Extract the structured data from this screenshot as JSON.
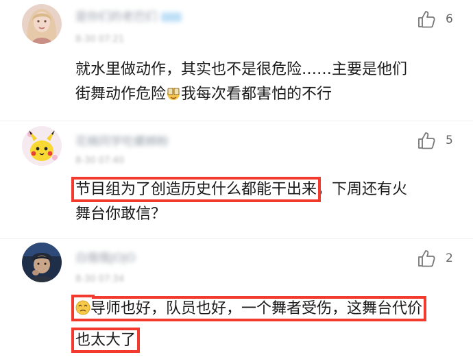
{
  "comments": [
    {
      "username": "是你们的老巴们",
      "time": "8-30 07:21",
      "likes": "6",
      "lines": [
        "就水里做动作，其实也不是很危险……主要是他们",
        "街舞动作危险",
        "我每次看都害怕的不行"
      ],
      "emoji": "cheers-emoji"
    },
    {
      "username": "花楠同学吃螺蛳粉",
      "time": "8-30 07:40",
      "likes": "5",
      "highlight": "节目组为了创造历史什么都能干出来",
      "rest": "，下周还有火",
      "line2": "舞台你敢信？"
    },
    {
      "username": "白俄俄JOJO",
      "time": "8-30 07:34",
      "likes": "2",
      "line1": "导师也好，队员也好，一个舞者受伤，这舞台代价",
      "line2": "也太大了",
      "emoji": "pleading-emoji"
    }
  ],
  "colors": {
    "highlight_border": "#f23a2e",
    "meta_text": "#b5b5b5",
    "body_text": "#1a1a1a"
  }
}
